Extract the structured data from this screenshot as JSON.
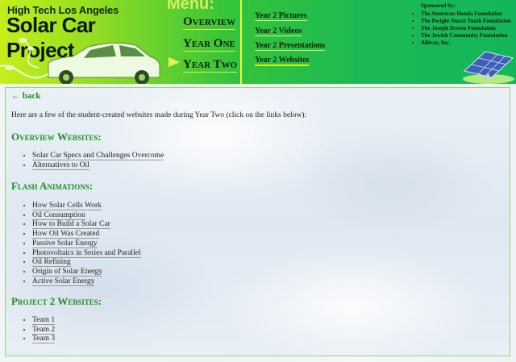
{
  "header": {
    "site_subtitle": "High Tech Los Angeles",
    "site_title": "Solar Car Project",
    "menu_title": "Menu:",
    "main_menu": [
      {
        "label": "Overview"
      },
      {
        "label": "Year One"
      },
      {
        "label": "Year Two",
        "active": true
      }
    ],
    "year_menu": [
      {
        "label": "Year 2 Pictures"
      },
      {
        "label": "Year 2 Videos"
      },
      {
        "label": "Year 2 Presentations"
      },
      {
        "label": "Year 2 Websites",
        "active": true
      }
    ],
    "sponsors": {
      "title": "Sponsored by:",
      "items": [
        "The American Honda Foundation",
        "The Dwight Stuart Youth Foundation",
        "The Joseph Drown Foundation",
        "The Jewish Community Foundation",
        "Alltrax, Inc."
      ]
    },
    "colors": {
      "brand_green": "#1cba55",
      "accent_lime": "#c6ee1b",
      "heading_green": "#1c8f1c"
    }
  },
  "content": {
    "back_link": "← back",
    "intro": "Here are a few of the student-created websites made during Year Two (click on the links below):",
    "sections": [
      {
        "heading": "Overview Websites:",
        "links": [
          "Solar Car Specs and Challenges Overcome",
          "Alternatives to Oil"
        ]
      },
      {
        "heading": "Flash Animations:",
        "links": [
          "How Solar Cells Work",
          "Oil Consumption",
          "How to Build a Solar Car",
          "How Oil Was Created",
          "Passive Solar Energy",
          "Photovoltaics in Series and Parallel",
          "Oil Refining",
          "Origin of Solar Energy",
          "Active Solar Energy"
        ]
      },
      {
        "heading": "Project 2 Websites:",
        "links": [
          "Team 1",
          "Team 2",
          "Team 3"
        ]
      }
    ]
  }
}
